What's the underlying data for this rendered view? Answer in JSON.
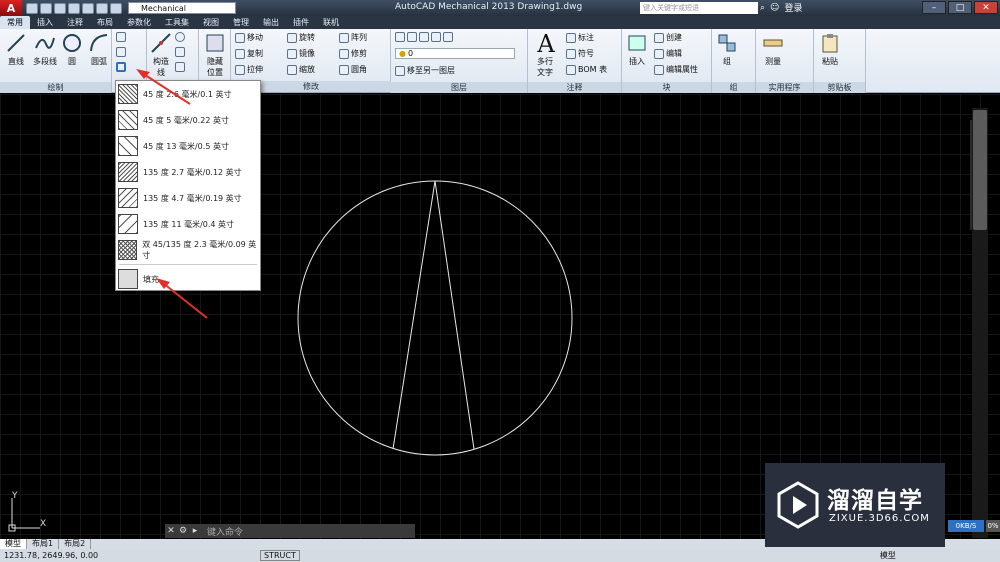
{
  "app": {
    "title": "AutoCAD Mechanical 2013    Drawing1.dwg",
    "logo": "A",
    "workspace": "Mechanical",
    "search_placeholder": "键入关键字或短语",
    "login": "登录"
  },
  "tabs": [
    "常用",
    "插入",
    "注释",
    "布局",
    "参数化",
    "工具集",
    "视图",
    "管理",
    "输出",
    "插件",
    "联机"
  ],
  "ribbon": {
    "draw": {
      "title": "绘制",
      "line": "直线",
      "polyline": "多段线",
      "circle": "圆",
      "arc": "圆弧"
    },
    "construct": {
      "line1": "构造",
      "line2": "线"
    },
    "hide": {
      "line1": "隐藏",
      "line2": "位置"
    },
    "modify": {
      "title": "修改",
      "items": [
        "移动",
        "旋转",
        "阵列",
        "复制",
        "镜像",
        "修剪",
        "拉伸",
        "缩放",
        "圆角"
      ]
    },
    "layers": {
      "title": "图层",
      "layer_value": "0",
      "move_to_layer": "移至另一图层"
    },
    "annotation": {
      "title": "注释",
      "text": "多行文字",
      "dim": "标注",
      "symbol": "符号",
      "bom": "BOM 表"
    },
    "block": {
      "title": "块",
      "insert": "插入",
      "create": "创建",
      "edit": "编辑",
      "edit_attr": "编辑属性"
    },
    "group": {
      "title": "组",
      "label": "组"
    },
    "utilities": {
      "title": "实用程序",
      "measure": "测量"
    },
    "clipboard": {
      "title": "剪贴板",
      "paste": "粘贴"
    }
  },
  "hatch_menu": {
    "items": [
      "45 度 2.6 毫米/0.1 英寸",
      "45 度 5 毫米/0.22 英寸",
      "45 度 13 毫米/0.5 英寸",
      "135 度 2.7 毫米/0.12 英寸",
      "135 度 4.7 毫米/0.19 英寸",
      "135 度 11 毫米/0.4 英寸",
      "双 45/135 度 2.3 毫米/0.09 英寸"
    ],
    "fill": "填充"
  },
  "command": {
    "placeholder": "键入命令"
  },
  "layout_tabs": [
    "模型",
    "布局1",
    "布局2"
  ],
  "status": {
    "coords": "1231.78, 2649.96, 0.00",
    "mode": "STRUCT",
    "model": "模型",
    "perf": "0KB/S",
    "perf2": "0%"
  },
  "watermark": {
    "title": "溜溜自学",
    "url": "ZIXUE.3D66.COM"
  },
  "ucs": {
    "x": "X",
    "y": "Y"
  }
}
